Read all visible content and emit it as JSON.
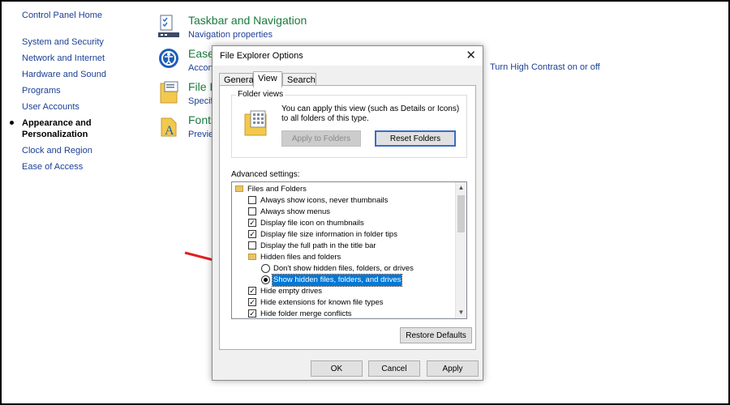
{
  "control_panel": {
    "home_link": "Control Panel Home",
    "nav_items": [
      {
        "label": "System and Security"
      },
      {
        "label": "Network and Internet"
      },
      {
        "label": "Hardware and Sound"
      },
      {
        "label": "Programs"
      },
      {
        "label": "User Accounts"
      },
      {
        "label": "Appearance and Personalization",
        "active": true
      },
      {
        "label": "Clock and Region"
      },
      {
        "label": "Ease of Access"
      }
    ],
    "categories": [
      {
        "title": "Taskbar and Navigation",
        "link": "Navigation properties",
        "icon": "taskbar-icon"
      },
      {
        "title": "Ease",
        "link": "Accon",
        "icon": "ease-of-access-icon"
      },
      {
        "title": "File E",
        "link": "Specif",
        "icon": "file-explorer-icon"
      },
      {
        "title": "Fonts",
        "link": "Previe",
        "icon": "fonts-icon"
      }
    ],
    "high_contrast_link": "Turn High Contrast on or off"
  },
  "dialog": {
    "title": "File Explorer Options",
    "close_label": "✕",
    "tabs": [
      {
        "label": "General"
      },
      {
        "label": "View",
        "selected": true
      },
      {
        "label": "Search"
      }
    ],
    "folder_views": {
      "legend": "Folder views",
      "description": "You can apply this view (such as Details or Icons) to all folders of this type.",
      "apply_button": "Apply to Folders",
      "reset_button": "Reset Folders"
    },
    "advanced_label": "Advanced settings:",
    "tree": [
      {
        "type": "folder",
        "label": "Files and Folders",
        "indent": 0
      },
      {
        "type": "check",
        "label": "Always show icons, never thumbnails",
        "checked": false,
        "indent": 1
      },
      {
        "type": "check",
        "label": "Always show menus",
        "checked": false,
        "indent": 1
      },
      {
        "type": "check",
        "label": "Display file icon on thumbnails",
        "checked": true,
        "indent": 1
      },
      {
        "type": "check",
        "label": "Display file size information in folder tips",
        "checked": true,
        "indent": 1
      },
      {
        "type": "check",
        "label": "Display the full path in the title bar",
        "checked": false,
        "indent": 1
      },
      {
        "type": "folder",
        "label": "Hidden files and folders",
        "indent": 1
      },
      {
        "type": "radio",
        "label": "Don't show hidden files, folders, or drives",
        "checked": false,
        "indent": 2
      },
      {
        "type": "radio",
        "label": "Show hidden files, folders, and drives",
        "checked": true,
        "indent": 2,
        "selected": true
      },
      {
        "type": "check",
        "label": "Hide empty drives",
        "checked": true,
        "indent": 1
      },
      {
        "type": "check",
        "label": "Hide extensions for known file types",
        "checked": true,
        "indent": 1
      },
      {
        "type": "check",
        "label": "Hide folder merge conflicts",
        "checked": true,
        "indent": 1
      }
    ],
    "scroll_up": "▲",
    "scroll_down": "▼",
    "restore_button": "Restore Defaults",
    "ok_button": "OK",
    "cancel_button": "Cancel",
    "apply_button": "Apply"
  },
  "colors": {
    "link": "#1c3f94",
    "category_title": "#1a7a3c",
    "selection": "#0078d7",
    "arrow": "#e02020"
  }
}
